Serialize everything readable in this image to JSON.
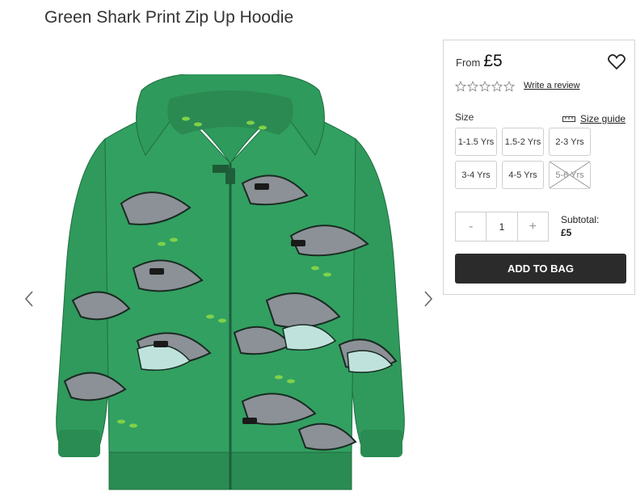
{
  "product": {
    "title": "Green Shark Print Zip Up Hoodie",
    "price_prefix": "From",
    "price": "£5",
    "review_link": "Write a review",
    "rating": 0,
    "max_rating": 5
  },
  "size": {
    "label": "Size",
    "guide_label": "Size guide",
    "options": [
      {
        "label": "1-1.5 Yrs",
        "available": true
      },
      {
        "label": "1.5-2 Yrs",
        "available": true
      },
      {
        "label": "2-3 Yrs",
        "available": true
      },
      {
        "label": "3-4 Yrs",
        "available": true
      },
      {
        "label": "4-5 Yrs",
        "available": true
      },
      {
        "label": "5-6 Yrs",
        "available": false
      }
    ]
  },
  "quantity": {
    "minus": "-",
    "value": "1",
    "plus": "+"
  },
  "subtotal": {
    "label": "Subtotal:",
    "value": "£5"
  },
  "actions": {
    "add_to_bag": "ADD TO BAG"
  },
  "icons": {
    "prev": "chevron-left-icon",
    "next": "chevron-right-icon",
    "wishlist": "heart-icon",
    "ruler": "ruler-icon",
    "star": "star-outline-icon"
  },
  "colors": {
    "hoodie_green": "#2f9a5c",
    "button_dark": "#2b2b2b",
    "border": "#d4d4d4"
  }
}
